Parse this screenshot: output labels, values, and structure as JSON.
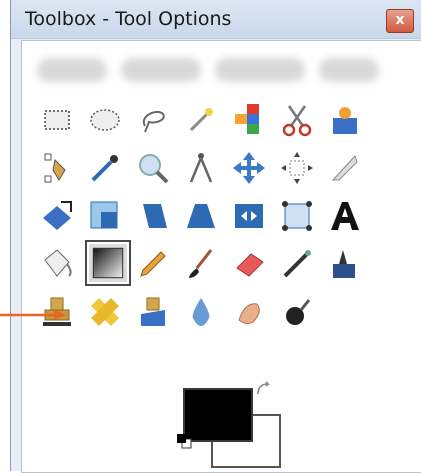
{
  "window": {
    "title": "Toolbox - Tool Options",
    "close_label": "x"
  },
  "tools": [
    {
      "name": "rect-select-tool",
      "icon": "rectangle-select-icon"
    },
    {
      "name": "ellipse-select-tool",
      "icon": "ellipse-select-icon"
    },
    {
      "name": "free-select-tool",
      "icon": "lasso-icon"
    },
    {
      "name": "fuzzy-select-tool",
      "icon": "magic-wand-icon"
    },
    {
      "name": "select-by-color-tool",
      "icon": "color-select-icon"
    },
    {
      "name": "scissors-select-tool",
      "icon": "scissors-icon"
    },
    {
      "name": "foreground-select-tool",
      "icon": "foreground-select-icon"
    },
    {
      "name": "paths-tool",
      "icon": "pen-path-icon"
    },
    {
      "name": "color-picker-tool",
      "icon": "eyedropper-icon"
    },
    {
      "name": "zoom-tool",
      "icon": "magnifier-icon"
    },
    {
      "name": "measure-tool",
      "icon": "compass-icon"
    },
    {
      "name": "move-tool",
      "icon": "move-arrows-icon"
    },
    {
      "name": "alignment-tool",
      "icon": "align-icon"
    },
    {
      "name": "crop-tool",
      "icon": "crop-knife-icon"
    },
    {
      "name": "rotate-tool",
      "icon": "rotate-icon"
    },
    {
      "name": "scale-tool",
      "icon": "scale-icon"
    },
    {
      "name": "shear-tool",
      "icon": "shear-icon"
    },
    {
      "name": "perspective-tool",
      "icon": "perspective-icon"
    },
    {
      "name": "flip-tool",
      "icon": "flip-icon"
    },
    {
      "name": "cage-transform-tool",
      "icon": "cage-icon"
    },
    {
      "name": "text-tool",
      "icon": "text-a-icon"
    },
    {
      "name": "bucket-fill-tool",
      "icon": "paint-bucket-icon"
    },
    {
      "name": "blend-tool",
      "icon": "gradient-icon"
    },
    {
      "name": "pencil-tool",
      "icon": "pencil-icon"
    },
    {
      "name": "paintbrush-tool",
      "icon": "paintbrush-icon"
    },
    {
      "name": "eraser-tool",
      "icon": "eraser-icon"
    },
    {
      "name": "airbrush-tool",
      "icon": "airbrush-icon"
    },
    {
      "name": "ink-tool",
      "icon": "ink-icon"
    },
    {
      "name": "clone-tool",
      "icon": "stamp-icon"
    },
    {
      "name": "heal-tool",
      "icon": "bandage-icon"
    },
    {
      "name": "perspective-clone-tool",
      "icon": "perspective-stamp-icon"
    },
    {
      "name": "blur-sharpen-tool",
      "icon": "water-drop-icon"
    },
    {
      "name": "smudge-tool",
      "icon": "smudge-finger-icon"
    },
    {
      "name": "dodge-burn-tool",
      "icon": "dodge-burn-icon"
    }
  ],
  "selected_tool": "blend-tool",
  "colors": {
    "foreground": "#000000",
    "background": "#ffffff",
    "accent_arrow": "#e8662a"
  }
}
